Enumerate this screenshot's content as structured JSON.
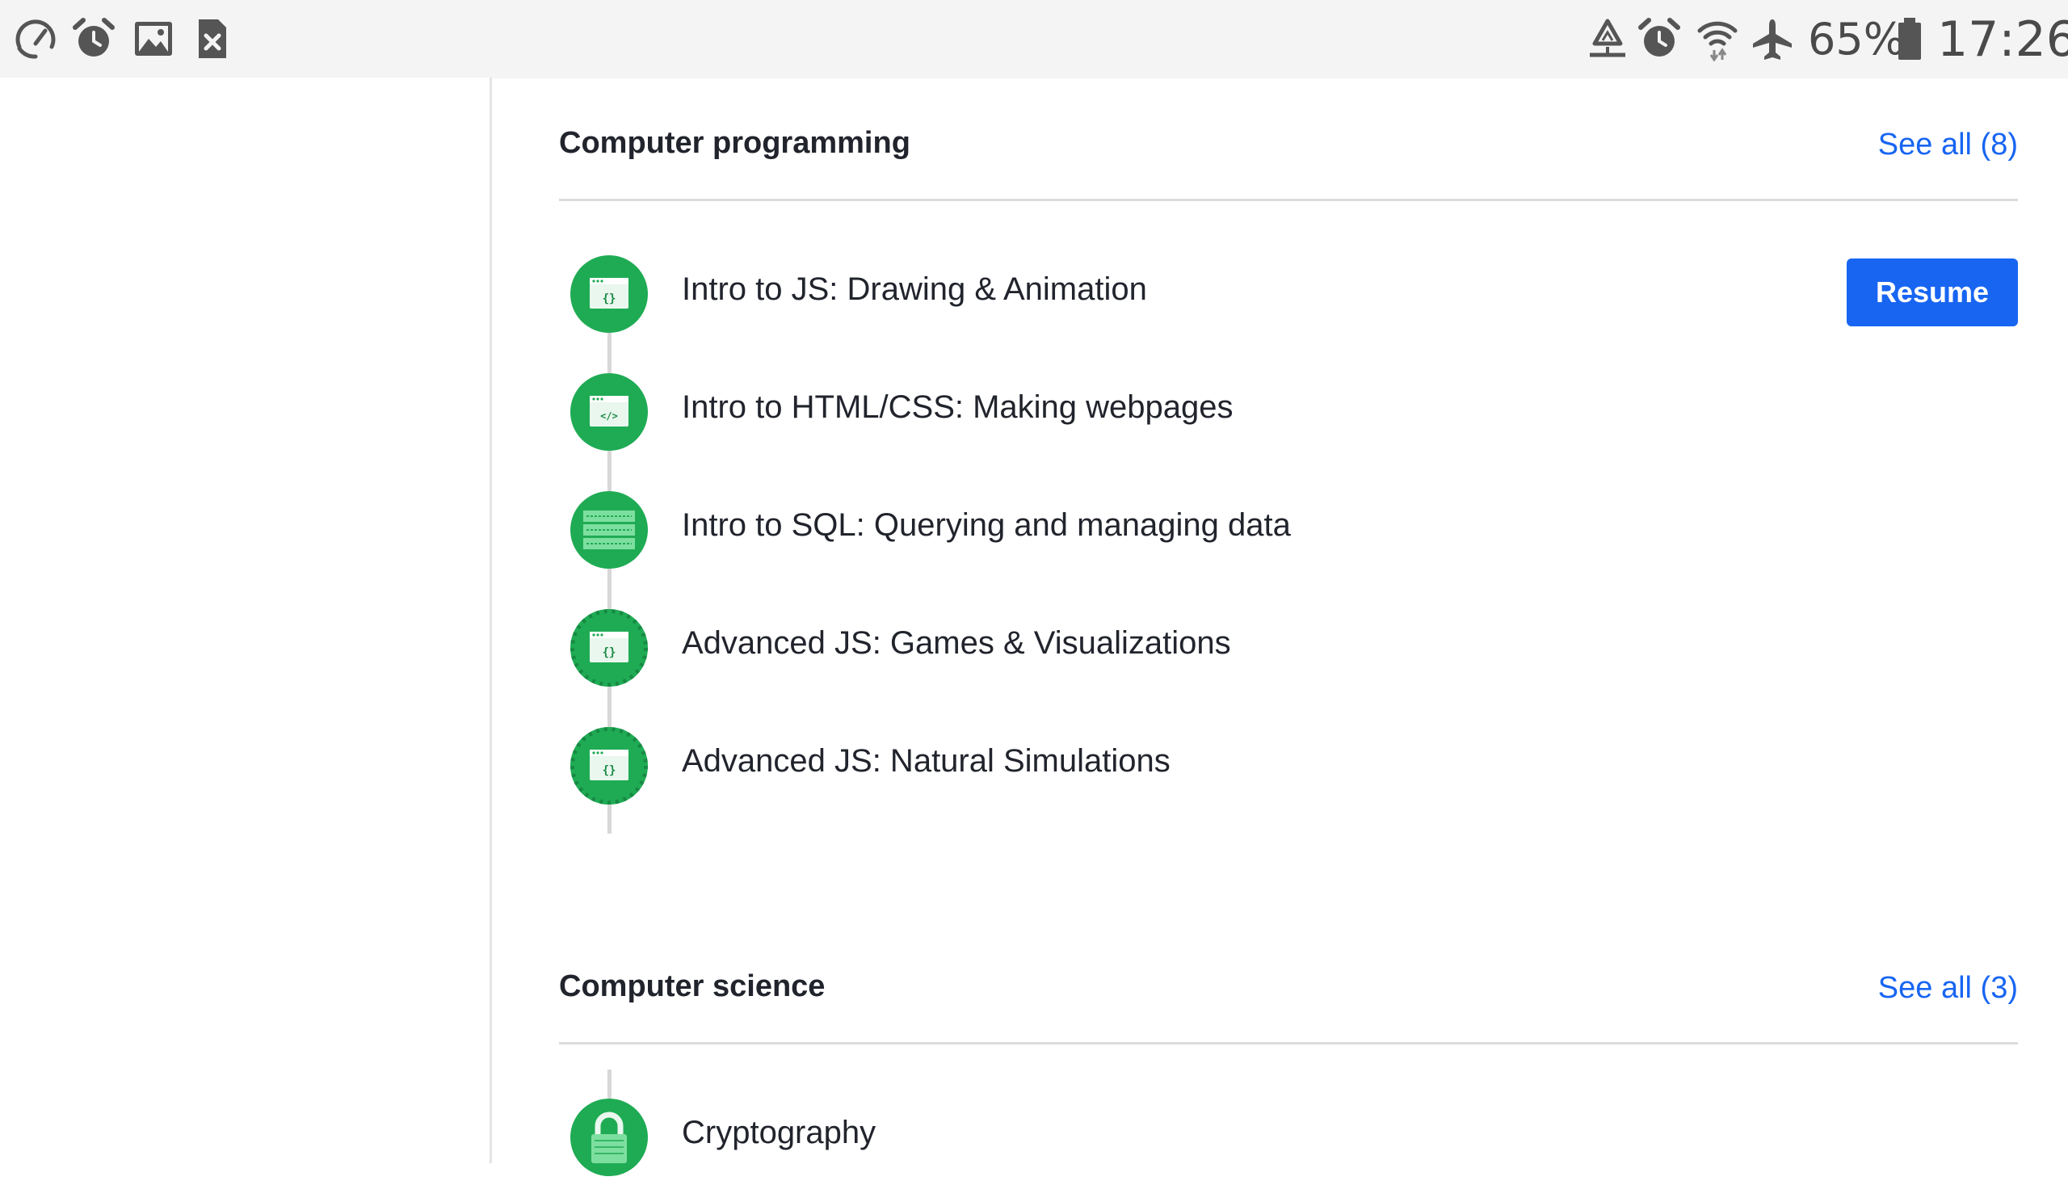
{
  "status_bar": {
    "left_icons": [
      "speedometer-icon",
      "alarm-icon",
      "gallery-icon",
      "sim-error-icon"
    ],
    "right_icons": [
      "recycle-sync-icon",
      "alarm-icon",
      "wifi-icon",
      "airplane-mode-icon",
      "battery-icon"
    ],
    "battery_percent": "65%",
    "time": "17:26"
  },
  "sections": [
    {
      "title": "Computer programming",
      "see_all": "See all (8)",
      "courses": [
        {
          "title": "Intro to JS: Drawing & Animation",
          "icon": "js-code-icon",
          "action": "Resume"
        },
        {
          "title": "Intro to HTML/CSS: Making webpages",
          "icon": "html-code-icon"
        },
        {
          "title": "Intro to SQL: Querying and managing data",
          "icon": "database-icon"
        },
        {
          "title": "Advanced JS: Games & Visualizations",
          "icon": "js-code-icon"
        },
        {
          "title": "Advanced JS: Natural Simulations",
          "icon": "js-code-icon"
        }
      ]
    },
    {
      "title": "Computer science",
      "see_all": "See all (3)",
      "courses": [
        {
          "title": "Cryptography",
          "icon": "lock-icon"
        }
      ]
    }
  ],
  "colors": {
    "accent_blue": "#1865f2",
    "course_green": "#1fab54",
    "text_dark": "#21242c",
    "status_bar_bg": "#f4f4f4"
  }
}
